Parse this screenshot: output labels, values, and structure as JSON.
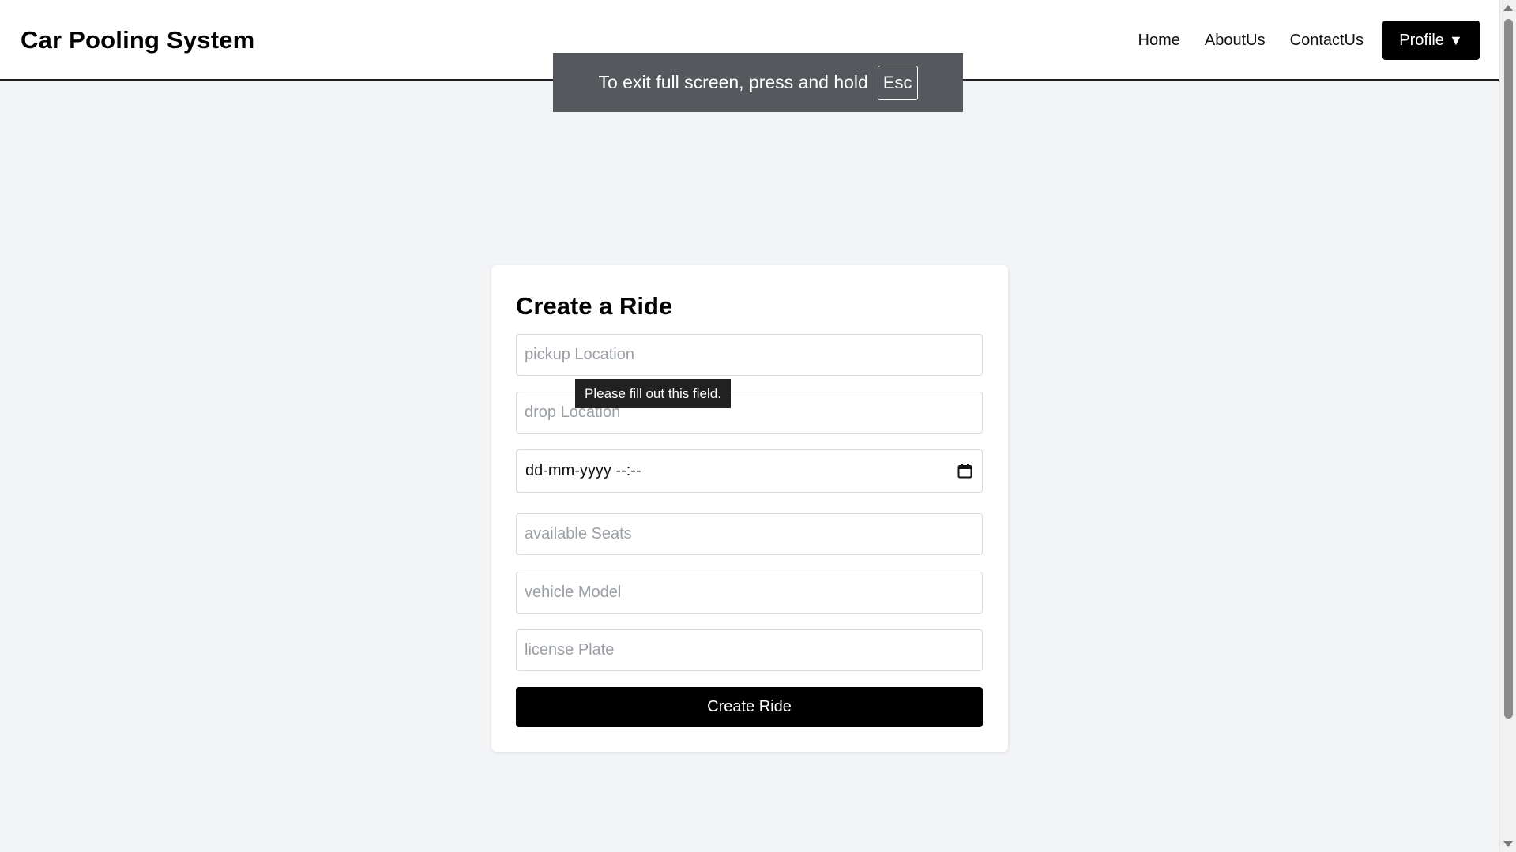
{
  "header": {
    "brand": "Car Pooling System",
    "nav": [
      "Home",
      "AboutUs",
      "ContactUs"
    ],
    "profile_label": "Profile",
    "profile_caret": "▼"
  },
  "fullscreen_notice": {
    "text": "To exit full screen, press and hold",
    "key": "Esc"
  },
  "form": {
    "title": "Create a Ride",
    "pickup_placeholder": "pickup Location",
    "drop_placeholder": "drop Location",
    "datetime_value": "dd-mm-yyyy --:--",
    "seats_placeholder": "available Seats",
    "vehicle_placeholder": "vehicle Model",
    "license_placeholder": "license Plate",
    "submit_label": "Create Ride",
    "validation_tooltip": "Please fill out this field."
  },
  "icons": {
    "calendar": "calendar-icon",
    "caret": "chevron-down-icon"
  }
}
